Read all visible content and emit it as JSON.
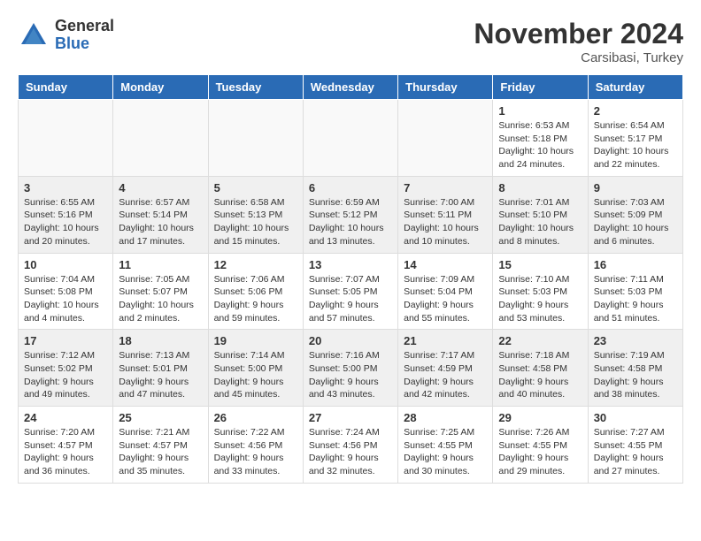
{
  "logo": {
    "general": "General",
    "blue": "Blue"
  },
  "title": "November 2024",
  "subtitle": "Carsibasi, Turkey",
  "headers": [
    "Sunday",
    "Monday",
    "Tuesday",
    "Wednesday",
    "Thursday",
    "Friday",
    "Saturday"
  ],
  "weeks": [
    [
      {
        "day": "",
        "text": ""
      },
      {
        "day": "",
        "text": ""
      },
      {
        "day": "",
        "text": ""
      },
      {
        "day": "",
        "text": ""
      },
      {
        "day": "",
        "text": ""
      },
      {
        "day": "1",
        "text": "Sunrise: 6:53 AM\nSunset: 5:18 PM\nDaylight: 10 hours and 24 minutes."
      },
      {
        "day": "2",
        "text": "Sunrise: 6:54 AM\nSunset: 5:17 PM\nDaylight: 10 hours and 22 minutes."
      }
    ],
    [
      {
        "day": "3",
        "text": "Sunrise: 6:55 AM\nSunset: 5:16 PM\nDaylight: 10 hours and 20 minutes."
      },
      {
        "day": "4",
        "text": "Sunrise: 6:57 AM\nSunset: 5:14 PM\nDaylight: 10 hours and 17 minutes."
      },
      {
        "day": "5",
        "text": "Sunrise: 6:58 AM\nSunset: 5:13 PM\nDaylight: 10 hours and 15 minutes."
      },
      {
        "day": "6",
        "text": "Sunrise: 6:59 AM\nSunset: 5:12 PM\nDaylight: 10 hours and 13 minutes."
      },
      {
        "day": "7",
        "text": "Sunrise: 7:00 AM\nSunset: 5:11 PM\nDaylight: 10 hours and 10 minutes."
      },
      {
        "day": "8",
        "text": "Sunrise: 7:01 AM\nSunset: 5:10 PM\nDaylight: 10 hours and 8 minutes."
      },
      {
        "day": "9",
        "text": "Sunrise: 7:03 AM\nSunset: 5:09 PM\nDaylight: 10 hours and 6 minutes."
      }
    ],
    [
      {
        "day": "10",
        "text": "Sunrise: 7:04 AM\nSunset: 5:08 PM\nDaylight: 10 hours and 4 minutes."
      },
      {
        "day": "11",
        "text": "Sunrise: 7:05 AM\nSunset: 5:07 PM\nDaylight: 10 hours and 2 minutes."
      },
      {
        "day": "12",
        "text": "Sunrise: 7:06 AM\nSunset: 5:06 PM\nDaylight: 9 hours and 59 minutes."
      },
      {
        "day": "13",
        "text": "Sunrise: 7:07 AM\nSunset: 5:05 PM\nDaylight: 9 hours and 57 minutes."
      },
      {
        "day": "14",
        "text": "Sunrise: 7:09 AM\nSunset: 5:04 PM\nDaylight: 9 hours and 55 minutes."
      },
      {
        "day": "15",
        "text": "Sunrise: 7:10 AM\nSunset: 5:03 PM\nDaylight: 9 hours and 53 minutes."
      },
      {
        "day": "16",
        "text": "Sunrise: 7:11 AM\nSunset: 5:03 PM\nDaylight: 9 hours and 51 minutes."
      }
    ],
    [
      {
        "day": "17",
        "text": "Sunrise: 7:12 AM\nSunset: 5:02 PM\nDaylight: 9 hours and 49 minutes."
      },
      {
        "day": "18",
        "text": "Sunrise: 7:13 AM\nSunset: 5:01 PM\nDaylight: 9 hours and 47 minutes."
      },
      {
        "day": "19",
        "text": "Sunrise: 7:14 AM\nSunset: 5:00 PM\nDaylight: 9 hours and 45 minutes."
      },
      {
        "day": "20",
        "text": "Sunrise: 7:16 AM\nSunset: 5:00 PM\nDaylight: 9 hours and 43 minutes."
      },
      {
        "day": "21",
        "text": "Sunrise: 7:17 AM\nSunset: 4:59 PM\nDaylight: 9 hours and 42 minutes."
      },
      {
        "day": "22",
        "text": "Sunrise: 7:18 AM\nSunset: 4:58 PM\nDaylight: 9 hours and 40 minutes."
      },
      {
        "day": "23",
        "text": "Sunrise: 7:19 AM\nSunset: 4:58 PM\nDaylight: 9 hours and 38 minutes."
      }
    ],
    [
      {
        "day": "24",
        "text": "Sunrise: 7:20 AM\nSunset: 4:57 PM\nDaylight: 9 hours and 36 minutes."
      },
      {
        "day": "25",
        "text": "Sunrise: 7:21 AM\nSunset: 4:57 PM\nDaylight: 9 hours and 35 minutes."
      },
      {
        "day": "26",
        "text": "Sunrise: 7:22 AM\nSunset: 4:56 PM\nDaylight: 9 hours and 33 minutes."
      },
      {
        "day": "27",
        "text": "Sunrise: 7:24 AM\nSunset: 4:56 PM\nDaylight: 9 hours and 32 minutes."
      },
      {
        "day": "28",
        "text": "Sunrise: 7:25 AM\nSunset: 4:55 PM\nDaylight: 9 hours and 30 minutes."
      },
      {
        "day": "29",
        "text": "Sunrise: 7:26 AM\nSunset: 4:55 PM\nDaylight: 9 hours and 29 minutes."
      },
      {
        "day": "30",
        "text": "Sunrise: 7:27 AM\nSunset: 4:55 PM\nDaylight: 9 hours and 27 minutes."
      }
    ]
  ]
}
